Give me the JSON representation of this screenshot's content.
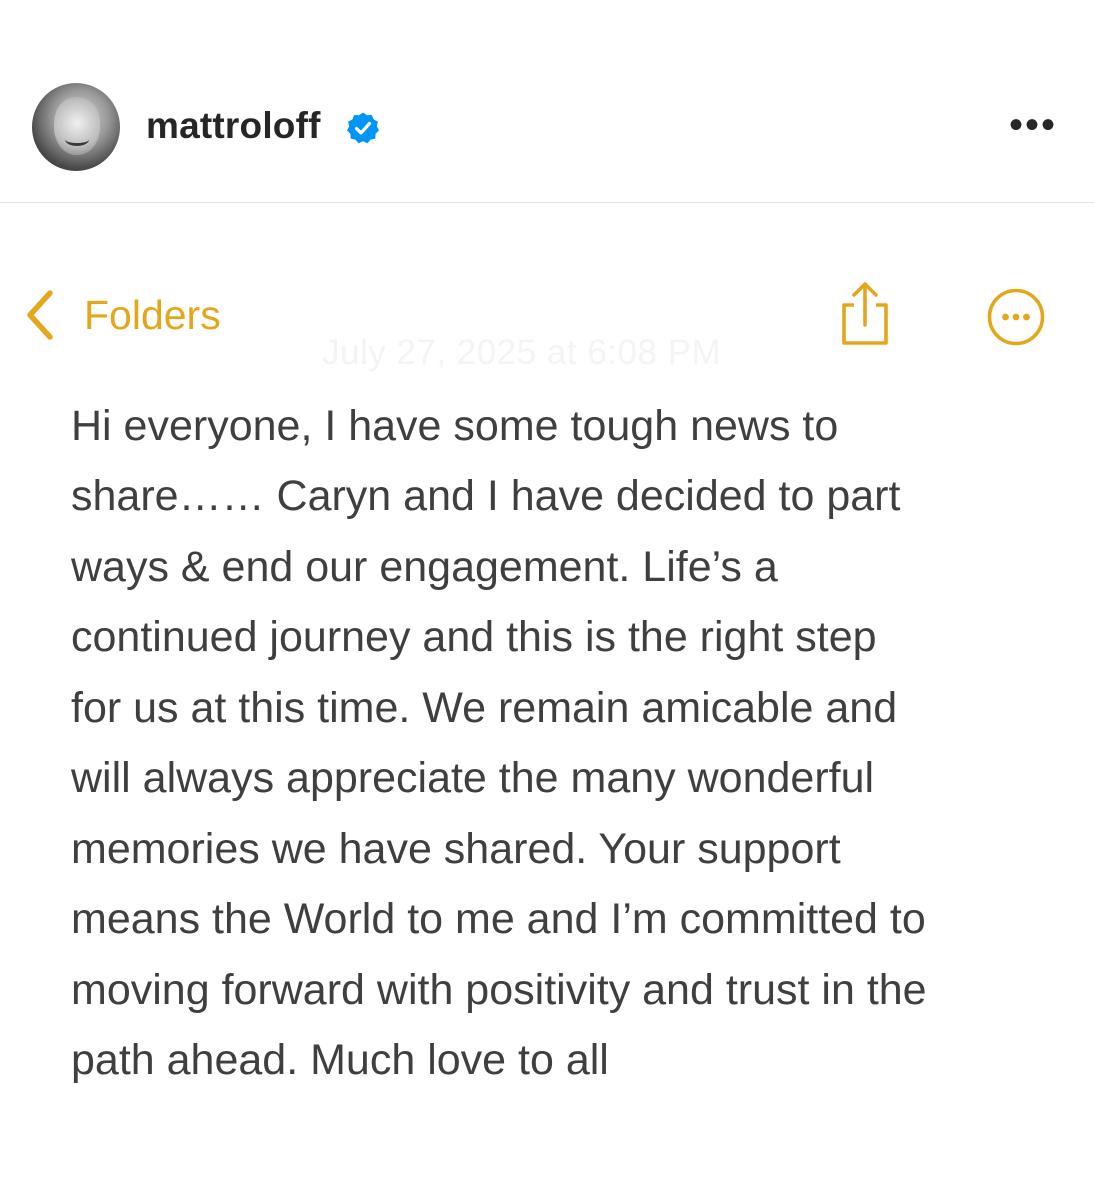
{
  "post_header": {
    "username": "mattroloff",
    "more_label": "•••",
    "avatar_icon": "profile-photo"
  },
  "notes_nav": {
    "back_label": "Folders",
    "back_icon": "chevron-left-icon",
    "share_icon": "share-icon",
    "more_icon": "ellipsis-circle-icon"
  },
  "note": {
    "date": "July 27, 2025 at 6:08 PM",
    "lines": [
      "Hi everyone, I have some tough news to",
      "share…… Caryn and I have decided to part",
      "ways & end our engagement.  Life’s a",
      "continued journey and this is the right step",
      "for us at this time.  We remain amicable and",
      "will always appreciate the many wonderful",
      "memories we have shared.  Your support",
      "means the World to me and I’m committed to",
      "moving forward with positivity and trust in the",
      "path ahead.  Much love to all"
    ]
  },
  "colors": {
    "accent": "#e3a71c",
    "verified": "#0095f6",
    "text": "#3f3f3f",
    "username": "#262626"
  }
}
